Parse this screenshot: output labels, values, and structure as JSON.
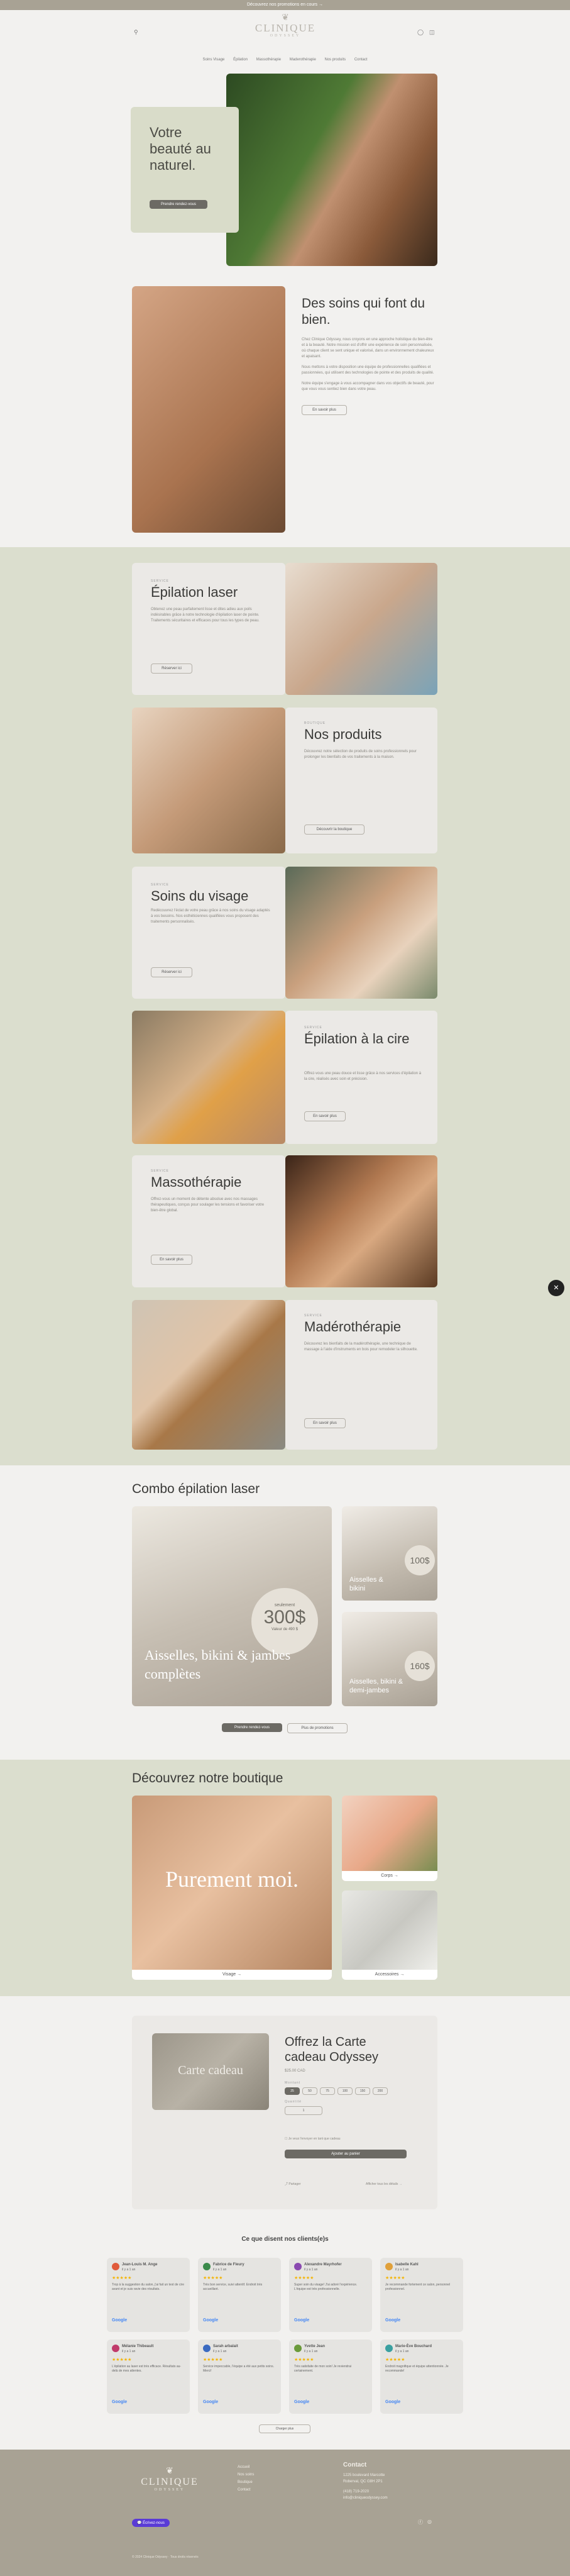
{
  "announcement": "Découvrez nos promotions en cours →",
  "logo": {
    "brand": "CLINIQUE",
    "sub": "ODYSSEY"
  },
  "nav": [
    "Soins Visage",
    "Épilation",
    "Massothérapie",
    "Maderothérapie",
    "Nos produits",
    "Contact"
  ],
  "hero": {
    "title": "Votre beauté au naturel.",
    "button": "Prendre rendez-vous"
  },
  "intro": {
    "title": "Des soins qui font du bien.",
    "p1": "Chez Clinique Odyssey, nous croyons en une approche holistique du bien-être et à la beauté. Notre mission est d'offrir une expérience de soin personnalisée, où chaque client se sent unique et valorisé, dans un environnement chaleureux et apaisant.",
    "p2": "Nous mettons à votre disposition une équipe de professionnelles qualifiées et passionnées, qui utilisent des technologies de pointe et des produits de qualité.",
    "p3": "Notre équipe s'engage à vous accompagner dans vos objectifs de beauté, pour que vous vous sentiez bien dans votre peau.",
    "button": "En savoir plus"
  },
  "services": [
    {
      "eyebrow": "SERVICE",
      "title": "Épilation laser",
      "text": "Obtenez une peau parfaitement lisse et dites adieu aux poils indésirables grâce à notre technologie d'épilation laser de pointe. Traitements sécuritaires et efficaces pour tous les types de peau.",
      "button": "Réserver ici"
    },
    {
      "eyebrow": "BOUTIQUE",
      "title": "Nos produits",
      "text": "Découvrez notre sélection de produits de soins professionnels pour prolonger les bienfaits de vos traitements à la maison.",
      "button": "Découvrir la boutique"
    },
    {
      "eyebrow": "SERVICE",
      "title": "Soins du visage",
      "text": "Redécouvrez l'éclat de votre peau grâce à nos soins du visage adaptés à vos besoins. Nos esthéticiennes qualifiées vous proposent des traitements personnalisés.",
      "button": "Réserver ici"
    },
    {
      "eyebrow": "SERVICE",
      "title": "Épilation à la cire",
      "text": "Offrez-vous une peau douce et lisse grâce à nos services d'épilation à la cire, réalisés avec soin et précision.",
      "button": "En savoir plus"
    },
    {
      "eyebrow": "SERVICE",
      "title": "Massothérapie",
      "text": "Offrez-vous un moment de détente absolue avec nos massages thérapeutiques, conçus pour soulager les tensions et favoriser votre bien-être global.",
      "button": "En savoir plus"
    },
    {
      "eyebrow": "SERVICE",
      "title": "Madérothérapie",
      "text": "Découvrez les bienfaits de la madérothérapie, une technique de massage à l'aide d'instruments en bois pour remodeler la silhouette.",
      "button": "En savoir plus"
    }
  ],
  "combo": {
    "title": "Combo épilation laser",
    "big_caption": "Aisselles, bikini & jambes complètes",
    "big_eyebrow": "seulement",
    "big_price": "300$",
    "big_note": "Valeur de 490 $",
    "small1_caption": "Aisselles & bikini",
    "small1_price": "100$",
    "small2_caption": "Aisselles, bikini & demi-jambes",
    "small2_price": "160$",
    "button1": "Prendre rendez-vous",
    "button2": "Plus de promotions"
  },
  "boutique": {
    "title": "Découvrez notre boutique",
    "overlay": "Purement moi.",
    "visage": "Visage →",
    "corps": "Corps →",
    "accessoires": "Accessoires →"
  },
  "giftcard": {
    "card_text": "Carte cadeau",
    "title": "Offrez la Carte cadeau Odyssey",
    "price": "$25.00 CAD",
    "amount_label": "Montant",
    "amounts": [
      "25",
      "50",
      "75",
      "100",
      "150",
      "200"
    ],
    "qty_label": "Quantité",
    "qty": "1",
    "checkbox": "Je veux l'envoyer en tant que cadeau",
    "button": "Ajouter au panier",
    "share": "Partager",
    "details": "Afficher tous les détails →"
  },
  "reviews": {
    "title": "Ce que disent nos clients(e)s",
    "button": "Charger plus",
    "items": [
      {
        "name": "Jean-Louis M. Ange",
        "date": "il y a 1 an",
        "text": "Trop à la suggestion du salon, j'ai fait un test de cire avant et je suis ravie des résultats.",
        "color": "#e05a3a"
      },
      {
        "name": "Fabrice de Fleury",
        "date": "il y a 1 an",
        "text": "Très bon service, suivi attentif. Endroit très accueillant.",
        "color": "#3a8a4a"
      },
      {
        "name": "Alexandre Mayrhofer",
        "date": "il y a 1 an",
        "text": "Super soin du visage! J'ai adoré l'expérience. L'équipe est très professionnelle.",
        "color": "#8a4ab0"
      },
      {
        "name": "Isabelle Kahl",
        "date": "il y a 1 an",
        "text": "Je recommande fortement ce salon, personnel professionnel.",
        "color": "#e0a03a"
      },
      {
        "name": "Mélanie Thibeault",
        "date": "il y a 1 an",
        "text": "L'épilation au laser est très efficace. Résultats au-delà de mes attentes.",
        "color": "#c03a6a"
      },
      {
        "name": "Sarah arbalait",
        "date": "il y a 1 an",
        "text": "Service impeccable, l'équipe a été aux petits soins. Merci!",
        "color": "#3a6ac0"
      },
      {
        "name": "Yvette Jean",
        "date": "il y a 1 an",
        "text": "Très satisfaite de mon soin! Je reviendrai certainement.",
        "color": "#6a9a3a"
      },
      {
        "name": "Marie-Ève Bouchard",
        "date": "il y a 1 an",
        "text": "Endroit magnifique et équipe attentionnée. Je recommande!",
        "color": "#3aa0a0"
      }
    ]
  },
  "footer": {
    "links": [
      "Accueil",
      "Nos soins",
      "Boutique",
      "Contact"
    ],
    "contact_title": "Contact",
    "address": "1225 boulevard Marcotte",
    "city": "Roberval, QC G8H 2P1",
    "phone": "(418) 719-2020",
    "email": "info@cliniqueodyssey.com",
    "chat": "Écrivez-nous",
    "copyright": "© 2024 Clinique Odyssey · Tous droits réservés"
  }
}
